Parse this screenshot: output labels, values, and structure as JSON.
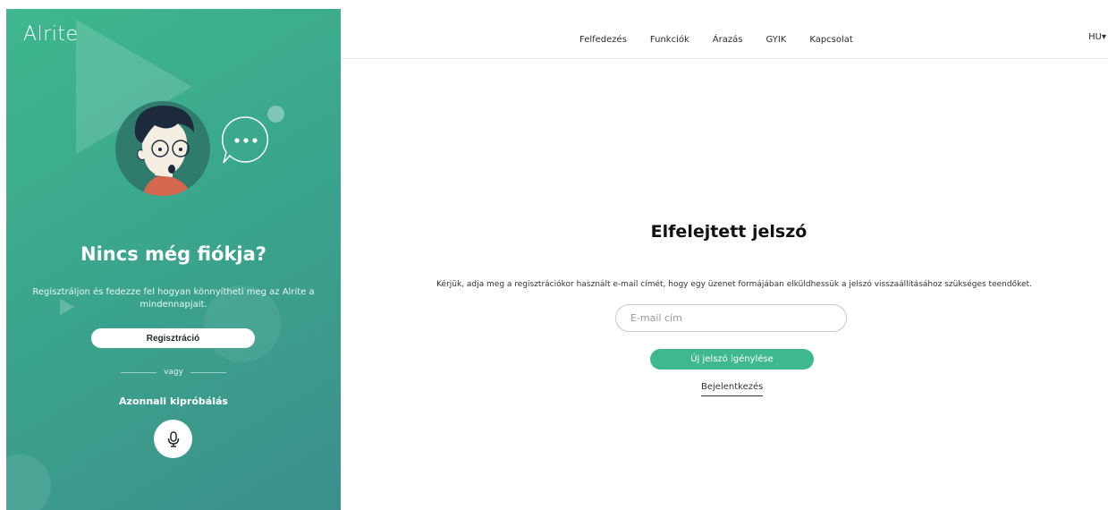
{
  "left_panel": {
    "logo": "Alrite",
    "heading": "Nincs még fiókja?",
    "description": "Regisztráljon és fedezze fel hogyan könnyítheti meg az Alrite a mindennapjait.",
    "register_button": "Regisztráció",
    "or_text": "vagy",
    "try_now": "Azonnali kipróbálás",
    "mic_icon": "microphone-icon"
  },
  "nav": {
    "items": [
      {
        "label": "Felfedezés"
      },
      {
        "label": "Funkciók"
      },
      {
        "label": "Árazás"
      },
      {
        "label": "GYIK"
      },
      {
        "label": "Kapcsolat"
      }
    ],
    "language": "HU▾"
  },
  "main": {
    "title": "Elfelejtett jelszó",
    "description": "Kérjük, adja meg a regisztrációkor használt e-mail címét, hogy egy üzenet formájában elküldhessük a jelszó visszaállításához szükséges teendőket.",
    "email_placeholder": "E-mail cím",
    "email_value": "",
    "submit_button": "Új jelszó igénylése",
    "login_link": "Bejelentkezés"
  },
  "colors": {
    "accent": "#3fb88f",
    "panel_gradient_start": "#3fb78f",
    "panel_gradient_end": "#3c8f8c"
  }
}
